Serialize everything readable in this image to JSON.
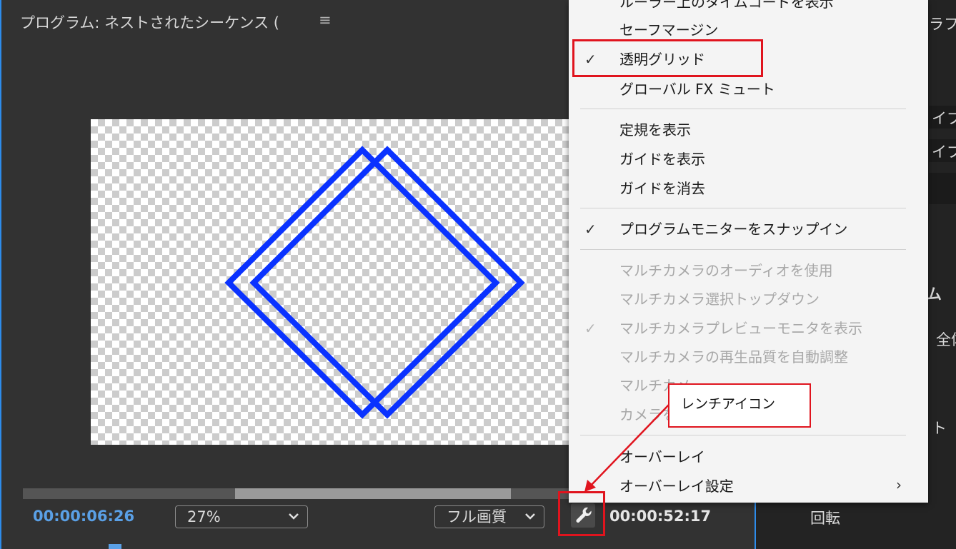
{
  "monitor": {
    "title": "プログラム: ネストされたシーケンス (",
    "menu_icon": "hamburger-icon",
    "current_time": "00:00:06:26",
    "zoom": "27%",
    "quality": "フル画質",
    "duration": "00:00:52:17",
    "wrench_icon": "wrench-icon",
    "shape_color": "#0a32ff"
  },
  "right_panel": {
    "texts": [
      "ラフ",
      "イプ (",
      "イプ (",
      "ム",
      "全体",
      "ト",
      "回転"
    ]
  },
  "menu": {
    "items": {
      "timecode": "ルーラー上のタイムコードを表示",
      "safe_margin": "セーフマージン",
      "transparency_grid": "透明グリッド",
      "global_fx_mute": "グローバル FX ミュート",
      "show_rulers": "定規を表示",
      "show_guides": "ガイドを表示",
      "clear_guides": "ガイドを消去",
      "snap_in_program_monitor": "プログラムモニターをスナップイン",
      "multicam_audio": "マルチカメラのオーディオを使用",
      "multicam_top_down": "マルチカメラ選択トップダウン",
      "multicam_preview": "マルチカメラプレビューモニタを表示",
      "multicam_quality": "マルチカメラの再生品質を自動調整",
      "multicam_partial_a": "マルチカメ",
      "multicam_partial_b": "カメラを",
      "overlay": "オーバーレイ",
      "overlay_settings": "オーバーレイ設定"
    },
    "check": "✓",
    "submenu_arrow": "›"
  },
  "annotation": {
    "callout_text": "レンチアイコン",
    "color": "#e0141e"
  }
}
